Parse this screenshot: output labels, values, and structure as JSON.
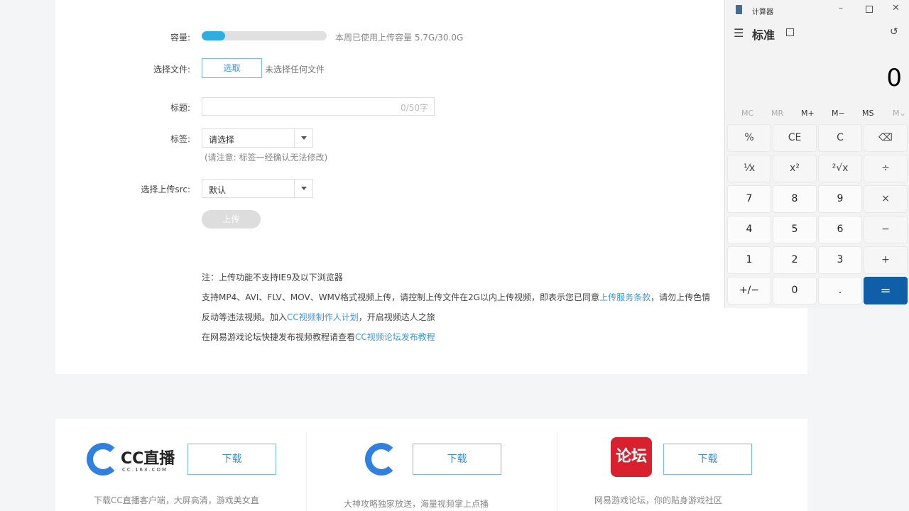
{
  "form": {
    "capacity_label": "容量:",
    "capacity_used_fraction": 0.19,
    "capacity_text": "本周已使用上传容量 5.7G/30.0G",
    "file_label": "选择文件:",
    "file_button": "选取",
    "file_status": "未选择任何文件",
    "title_label": "标题:",
    "title_counter": "0/50字",
    "tag_label": "标签:",
    "tag_value": "请选择",
    "tag_hint": "(请注意: 标签一经确认无法修改)",
    "src_label": "选择上传src:",
    "src_value": "默认",
    "upload_button": "上传"
  },
  "notes": {
    "line1": "注：上传功能不支持IE9及以下浏览器",
    "line2_a": "支持MP4、AVI、FLV、MOV、WMV格式视频上传，请控制上传文件在2G以内上传视频，即表示您已同意",
    "line2_link": "上传服务条款",
    "line2_b": "，请勿上传色情",
    "line3_a": "反动等违法视频。加入",
    "line3_link": "CC视频制作人计划",
    "line3_b": "，开启视频达人之旅",
    "line4_a": "在网易游戏论坛快捷发布视频教程请查看",
    "line4_link": "CC视频论坛发布教程"
  },
  "footer": {
    "items": [
      {
        "logo": "CC直播",
        "logo_sub": "CC.163.COM",
        "button": "下载",
        "desc": "下载CC直播客户端，大屏高清，游戏美女直"
      },
      {
        "button": "下载",
        "desc": "大神攻略独家放送，海量视频掌上点播"
      },
      {
        "logo": "论坛",
        "button": "下载",
        "desc": "网易游戏论坛，你的贴身游戏社区"
      }
    ]
  },
  "calculator": {
    "window_title": "计算器",
    "mode": "标准",
    "display": "0",
    "memory": [
      "MC",
      "MR",
      "M+",
      "M−",
      "MS",
      "M⌄"
    ],
    "keys": [
      "%",
      "CE",
      "C",
      "⌫",
      "¹⁄x",
      "x²",
      "²√x",
      "÷",
      "7",
      "8",
      "9",
      "×",
      "4",
      "5",
      "6",
      "−",
      "1",
      "2",
      "3",
      "+",
      "+/−",
      "0",
      ".",
      "="
    ]
  },
  "colors": {
    "accent": "#2eaee0",
    "link": "#3b9ad9",
    "equals": "#0f5ea8"
  }
}
